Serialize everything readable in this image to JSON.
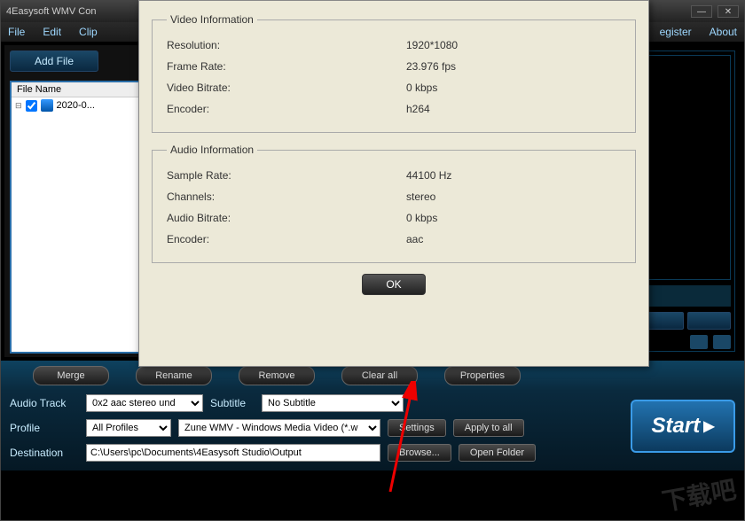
{
  "titlebar": {
    "title": "4Easysoft WMV Con"
  },
  "menubar": {
    "file": "File",
    "edit": "Edit",
    "clip": "Clip",
    "register": "egister",
    "about": "About"
  },
  "sidebar": {
    "add_file": "Add File",
    "file_header": "File Name",
    "file_item": "2020-0..."
  },
  "toolbar": {
    "merge": "Merge",
    "rename": "Rename",
    "remove": "Remove",
    "clear_all": "Clear all",
    "properties": "Properties"
  },
  "controls": {
    "audio_track_label": "Audio Track",
    "audio_track_value": "0x2 aac stereo und",
    "subtitle_label": "Subtitle",
    "subtitle_value": "No Subtitle",
    "profile_label": "Profile",
    "profile_cat": "All Profiles",
    "profile_value": "Zune WMV - Windows Media Video (*.w",
    "settings": "Settings",
    "apply_all": "Apply to all",
    "destination_label": "Destination",
    "destination_value": "C:\\Users\\pc\\Documents\\4Easysoft Studio\\Output",
    "browse": "Browse...",
    "open_folder": "Open Folder",
    "start": "Start"
  },
  "dialog": {
    "video_legend": "Video Information",
    "resolution_label": "Resolution:",
    "resolution_value": "1920*1080",
    "frame_rate_label": "Frame Rate:",
    "frame_rate_value": "23.976 fps",
    "video_bitrate_label": "Video Bitrate:",
    "video_bitrate_value": "0 kbps",
    "video_encoder_label": "Encoder:",
    "video_encoder_value": "h264",
    "audio_legend": "Audio Information",
    "sample_rate_label": "Sample Rate:",
    "sample_rate_value": "44100 Hz",
    "channels_label": "Channels:",
    "channels_value": "stereo",
    "audio_bitrate_label": "Audio Bitrate:",
    "audio_bitrate_value": "0 kbps",
    "audio_encoder_label": "Encoder:",
    "audio_encoder_value": "aac",
    "ok": "OK"
  },
  "watermark": "下载吧"
}
